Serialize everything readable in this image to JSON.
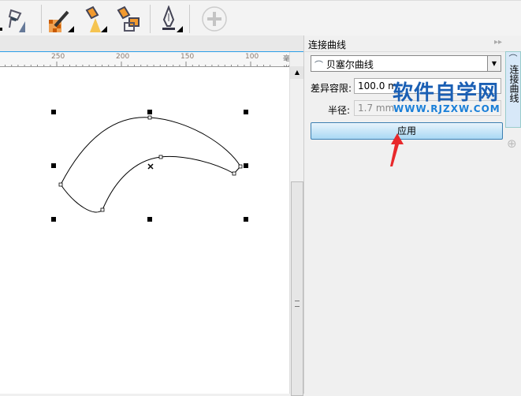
{
  "toolbar": {
    "icons": [
      "interactive-fill-icon",
      "color-eyedropper-icon",
      "paintbucket-icon",
      "attributes-eyedropper-icon",
      "pen-tool-icon",
      "add-icon"
    ]
  },
  "ruler": {
    "ticks": [
      "250",
      "200",
      "150",
      "100"
    ],
    "unit": "毫米"
  },
  "panel": {
    "title": "连接曲线",
    "mode": "贝塞尔曲线",
    "tolerance_label": "差异容限:",
    "tolerance_value": "100.0 m",
    "radius_label": "半径:",
    "radius_value": "1.7 mm",
    "apply_label": "应用",
    "tab_label": "连接曲线"
  },
  "watermark": {
    "title": "软件自学网",
    "url": "WWW.RJZXW.COM"
  }
}
